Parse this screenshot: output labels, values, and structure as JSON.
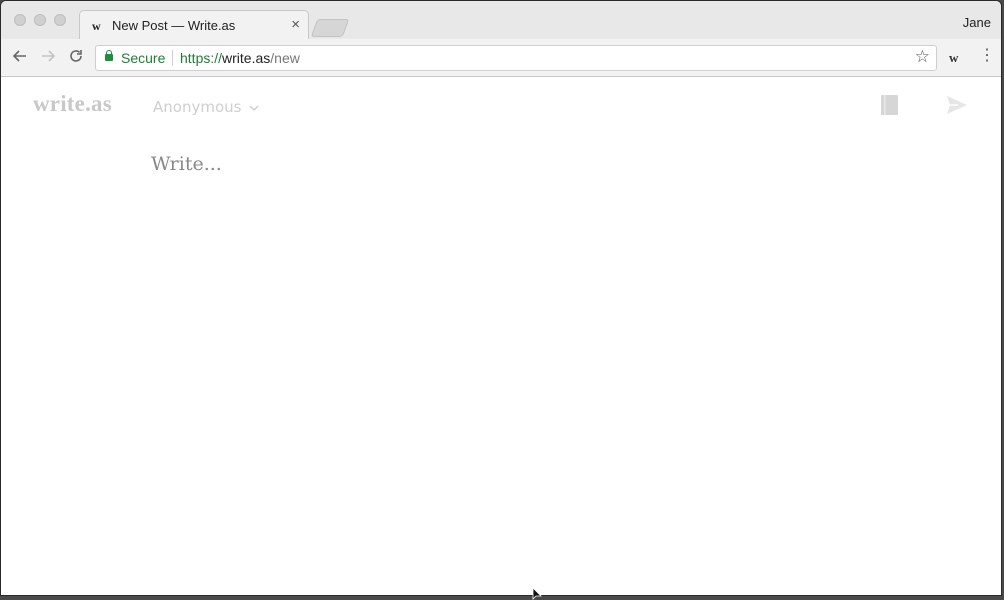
{
  "browser": {
    "profile_name": "Jane",
    "tab": {
      "favicon": "w",
      "title": "New Post — Write.as",
      "close_glyph": "×"
    },
    "toolbar": {
      "back_icon": "arrow-left-icon",
      "forward_icon": "arrow-right-icon",
      "reload_icon": "reload-icon",
      "secure_label": "Secure",
      "url": {
        "scheme": "https://",
        "host": "write.as",
        "path": "/new"
      },
      "extension_label": "w",
      "colors": {
        "secure": "#1e7e34"
      }
    }
  },
  "page": {
    "logo": "write.as",
    "blog_select": "Anonymous",
    "editor_placeholder": "Write...",
    "colors": {
      "logo": "#c8c8c8",
      "muted": "#cfcfcf",
      "placeholder": "#888888"
    }
  }
}
